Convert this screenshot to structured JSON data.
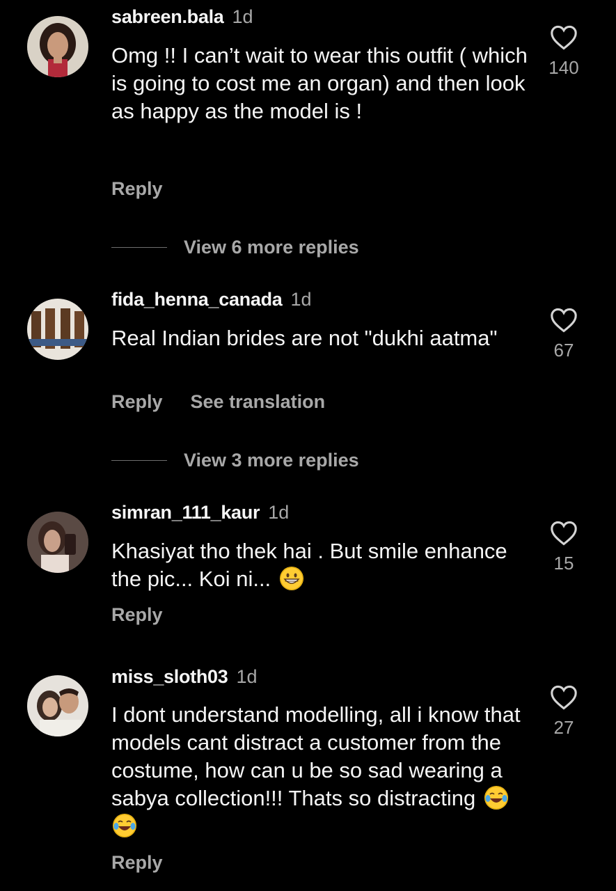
{
  "comments": [
    {
      "username": "sabreen.bala",
      "time": "1d",
      "text": "Omg !! I can’t wait to wear this outfit ( which is going to cost me an organ) and then look as happy as the model is !",
      "likes": "140",
      "reply_label": "Reply",
      "view_more": "View 6 more replies"
    },
    {
      "username": "fida_henna_canada",
      "time": "1d",
      "text": "Real Indian brides are not \"dukhi aatma\"",
      "likes": "67",
      "reply_label": "Reply",
      "translate_label": "See translation",
      "view_more": "View 3 more replies"
    },
    {
      "username": "simran_111_kaur",
      "time": "1d",
      "text": "Khasiyat tho thek hai . But smile enhance the pic... Koi ni...",
      "emoji": [
        "grinning-face-emoji"
      ],
      "likes": "15",
      "reply_label": "Reply"
    },
    {
      "username": "miss_sloth03",
      "time": "1d",
      "text": "I dont understand modelling, all i know that models cant distract a customer from the costume, how can u be so sad wearing a sabya collection!!! Thats so distracting",
      "emoji": [
        "tears-of-joy-emoji",
        "tears-of-joy-emoji"
      ],
      "likes": "27",
      "reply_label": "Reply"
    }
  ],
  "colors": {
    "background": "#000000",
    "primary_text": "#f5f5f5",
    "secondary_text": "#a8a8a8"
  }
}
